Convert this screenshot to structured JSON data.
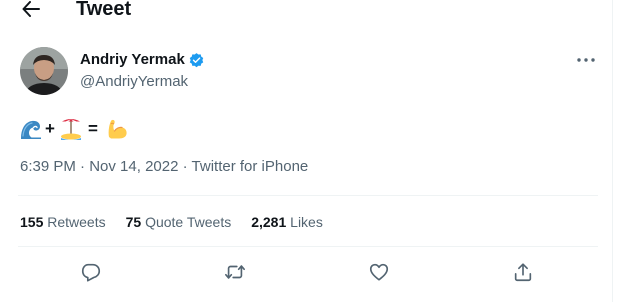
{
  "header": {
    "title": "Tweet",
    "back_icon": "arrow-left-icon"
  },
  "tweet": {
    "author": {
      "display_name": "Andriy Yermak",
      "handle": "@AndriyYermak",
      "verified": true,
      "verified_color": "#1d9bf0"
    },
    "body": {
      "plus": "+",
      "equals": "=",
      "emoji_names": [
        "water-wave-emoji",
        "desert-island-emoji",
        "flexed-biceps-emoji"
      ]
    },
    "time": "6:39 PM",
    "separator": "·",
    "date": "Nov 14, 2022",
    "source": "Twitter for iPhone"
  },
  "stats": {
    "retweets_count": "155",
    "retweets_label": "Retweets",
    "quotes_count": "75",
    "quotes_label": "Quote Tweets",
    "likes_count": "2,281",
    "likes_label": "Likes"
  },
  "actions": [
    "reply-icon",
    "retweet-icon",
    "like-icon",
    "share-icon"
  ],
  "colors": {
    "text_primary": "#0f1419",
    "text_secondary": "#536471",
    "divider": "#eff3f4",
    "accent": "#1d9bf0"
  }
}
